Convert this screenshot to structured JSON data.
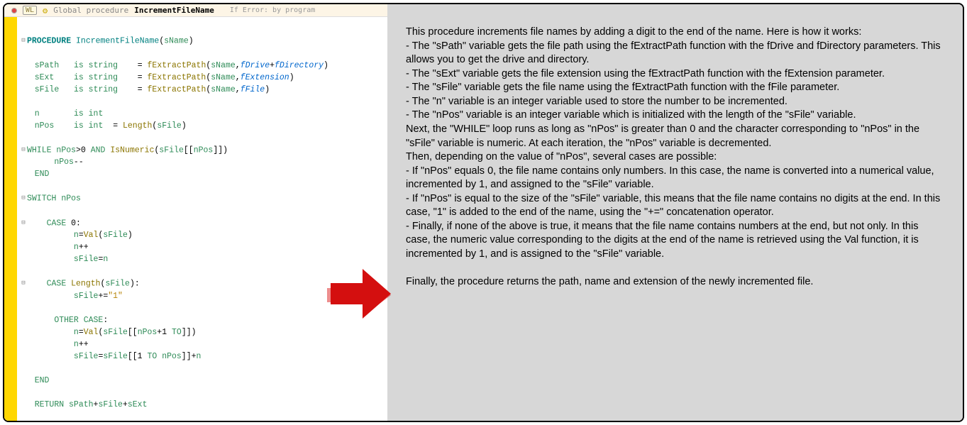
{
  "tab": {
    "wl_badge": "WL",
    "prefix": "Global procedure",
    "procname": "IncrementFileName",
    "error_text": "If Error: by program"
  },
  "code": {
    "l1a": "PROCEDURE ",
    "l1b": "IncrementFileName",
    "l1c": "(",
    "l1d": "sName",
    "l1e": ")",
    "l3a": "sPath",
    "l3b": "is ",
    "l3c": "string",
    "l3d": " = ",
    "l3e": "fExtractPath",
    "l3f": "(",
    "l3g": "sName",
    "l3h": ",",
    "l3i": "fDrive",
    "l3j": "+",
    "l3k": "fDirectory",
    "l3l": ")",
    "l4a": "sExt",
    "l4i": "fExtension",
    "l5a": "sFile",
    "l5i": "fFile",
    "l7a": "n",
    "l7c": "int",
    "l8a": "nPos",
    "l8e": "Length",
    "l8g": "sFile",
    "l10a": "WHILE ",
    "l10b": "nPos",
    "l10c": ">",
    "l10d": "0",
    "l10e": " AND ",
    "l10f": "IsNumeric",
    "l10g": "(",
    "l10h": "sFile",
    "l10i": "[[",
    "l10j": "nPos",
    "l10k": "]])",
    "l11a": "nPos",
    "l11b": "--",
    "l12a": "END",
    "l14a": "SWITCH ",
    "l14b": "nPos",
    "l16a": "CASE ",
    "l16b": "0",
    "l16c": ":",
    "l17a": "n",
    "l17b": "=",
    "l17c": "Val",
    "l17d": "(",
    "l17e": "sFile",
    "l17f": ")",
    "l18a": "n",
    "l18b": "++",
    "l19a": "sFile",
    "l19b": "=",
    "l19c": "n",
    "l21a": "CASE ",
    "l21b": "Length",
    "l21c": "(",
    "l21d": "sFile",
    "l21e": "):",
    "l22a": "sFile",
    "l22b": "+=",
    "l22c": "\"1\"",
    "l24a": "OTHER CASE",
    "l24b": ":",
    "l25a": "n",
    "l25b": "=",
    "l25c": "Val",
    "l25d": "(",
    "l25e": "sFile",
    "l25f": "[[",
    "l25g": "nPos",
    "l25h": "+",
    "l25i": "1",
    "l25j": " TO",
    "l25k": "]])",
    "l26a": "n",
    "l26b": "++",
    "l27a": "sFile",
    "l27b": "=",
    "l27c": "sFile",
    "l27d": "[[",
    "l27e": "1",
    "l27f": " TO ",
    "l27g": "nPos",
    "l27h": "]]+",
    "l27i": "n",
    "l29a": "END",
    "l31a": "RETURN ",
    "l31b": "sPath",
    "l31c": "+",
    "l31d": "sFile",
    "l31e": "+",
    "l31f": "sExt"
  },
  "desc": {
    "p1": "This procedure increments file names by adding a digit to the end of the name. Here is how it works:",
    "b1": "- The \"sPath\" variable gets the file path using the fExtractPath function with the fDrive and fDirectory parameters. This allows you to get the drive and directory.",
    "b2": "- The \"sExt\" variable gets the file extension using the fExtractPath function with the fExtension parameter.",
    "b3": "- The \"sFile\" variable gets the file name using the fExtractPath function with the fFile parameter.",
    "b4": "- The \"n\" variable is an integer variable used to store the number to be incremented.",
    "b5": "- The \"nPos\" variable is an integer variable which is initialized with the length of the \"sFile\" variable.",
    "p2": "Next, the \"WHILE\" loop runs as long as \"nPos\" is greater than 0 and the character corresponding to \"nPos\" in the \"sFile\" variable is numeric. At each iteration, the \"nPos\" variable is decremented.",
    "p3": "Then, depending on the value of \"nPos\", several cases are possible:",
    "c1": "- If \"nPos\" equals 0, the file name contains only numbers. In this case, the name is converted into a numerical value, incremented by 1, and assigned to the \"sFile\" variable.",
    "c2": "- If \"nPos\" is equal to the size of the \"sFile\" variable, this means that the file name contains no digits at the end. In this case, \"1\" is added to the end of the name, using the \"+=\" concatenation operator.",
    "c3": "- Finally, if none of the above is true, it means that the file name contains numbers at the end, but not only. In this case, the numeric value corresponding to the digits at the end of the name is retrieved using the Val function, it is incremented by 1, and is assigned to the \"sFile\" variable.",
    "p4": "Finally, the procedure returns the path, name and extension of the newly incremented file."
  }
}
